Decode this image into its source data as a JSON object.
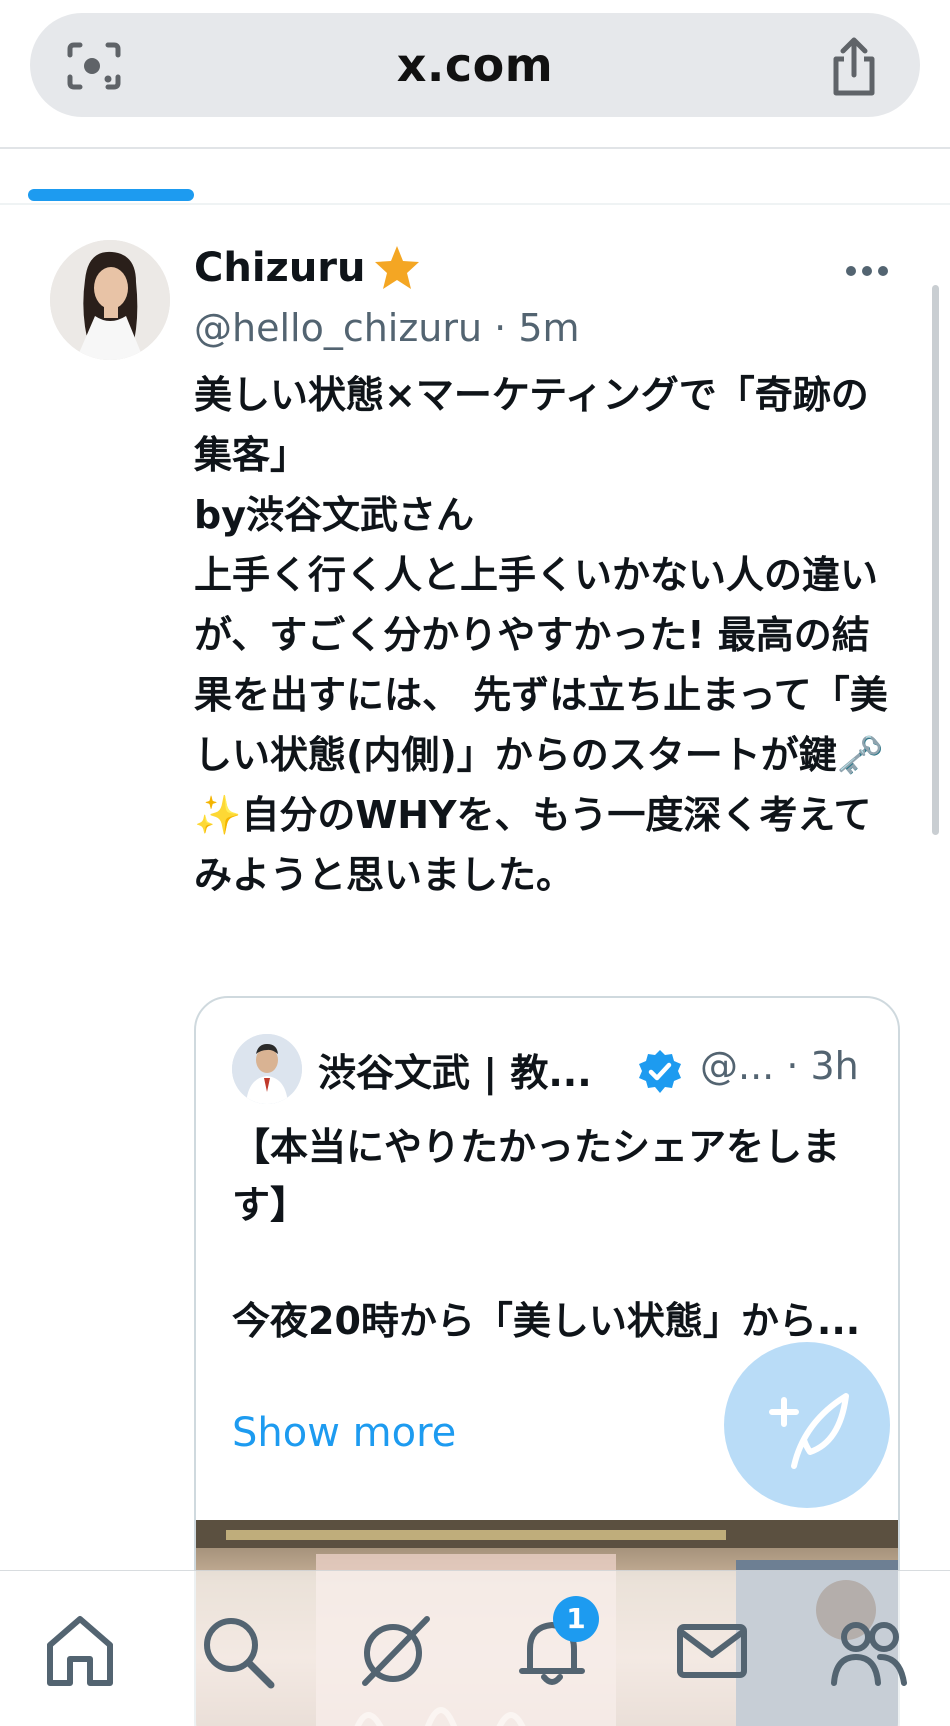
{
  "browser": {
    "url": "x.com",
    "lens_icon": "camera-search-icon",
    "share_icon": "share-icon"
  },
  "tweet": {
    "name": "Chizuru",
    "handle_time": "@hello_chizuru · 5m",
    "body": "美しい状態×マーケティングで「奇跡の集客」\nby渋谷文武さん\n上手く行く人と上手くいかない人の違いが、すごく分かりやすかった! 最高の結果を出すには、 先ずは立ち止まって「美しい状態(内側)」からのスタートが鍵🗝️✨自分のWHYを、もう一度深く考えてみようと思いました。"
  },
  "quote": {
    "name": "渋谷文武 | 教...",
    "handle_time": "@... · 3h",
    "body": "【本当にやりたかったシェアをします】\n\n今夜20時から「美しい状態」から...",
    "show_more": "Show more"
  },
  "nav": {
    "notification_count": "1",
    "items": [
      "home-icon",
      "search-icon",
      "grok-icon",
      "bell-icon",
      "mail-icon",
      "communities-icon"
    ]
  },
  "colors": {
    "accent": "#1d9bf0",
    "secondary_text": "#536471",
    "star": "#f4a623"
  }
}
